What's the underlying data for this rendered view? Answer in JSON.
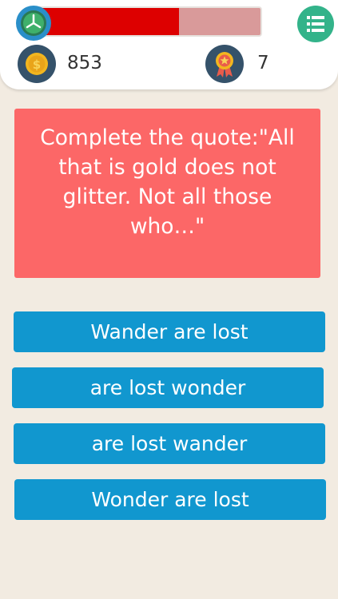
{
  "header": {
    "timer_progress": 0.64,
    "coins": "853",
    "medals": "7"
  },
  "question": {
    "text": "Complete the quote:\"All that is gold does not glitter. Not all those who…\""
  },
  "answers": [
    {
      "label": "Wander are lost"
    },
    {
      "label": "are lost wonder"
    },
    {
      "label": "are lost wander"
    },
    {
      "label": "Wonder are lost"
    }
  ],
  "colors": {
    "timer_fill": "#dd0000",
    "question_bg": "#fc6767",
    "answer_bg": "#1197cf",
    "menu_bg": "#33b38a",
    "background": "#f2ebe1"
  }
}
